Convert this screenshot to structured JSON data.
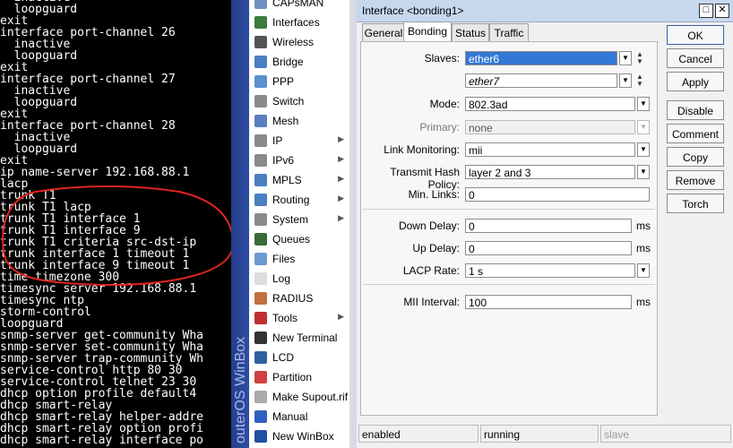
{
  "terminal": {
    "lines": [
      "  inactive",
      "  loopguard",
      "exit",
      "interface port-channel 26",
      "  inactive",
      "  loopguard",
      "exit",
      "interface port-channel 27",
      "  inactive",
      "  loopguard",
      "exit",
      "interface port-channel 28",
      "  inactive",
      "  loopguard",
      "exit",
      "ip name-server 192.168.88.1",
      "lacp",
      "trunk T1",
      "trunk T1 lacp",
      "trunk T1 interface 1",
      "trunk T1 interface 9",
      "trunk T1 criteria src-dst-ip",
      "trunk interface 1 timeout 1",
      "trunk interface 9 timeout 1",
      "time timezone 300",
      "timesync server 192.168.88.1",
      "timesync ntp",
      "storm-control",
      "loopguard",
      "snmp-server get-community Wha",
      "snmp-server set-community Wha",
      "snmp-server trap-community Wh",
      "service-control http 80 30",
      "service-control telnet 23 30",
      "dhcp option profile default4",
      "dhcp smart-relay",
      "dhcp smart-relay helper-addre",
      "dhcp smart-relay option profi",
      "dhcp smart-relay interface po"
    ]
  },
  "sidebar_brand": "outerOS WinBox",
  "menu": [
    {
      "label": "CAPsMAN",
      "icon": "capsman-icon",
      "color": "#6f8fc0",
      "arrow": false
    },
    {
      "label": "Interfaces",
      "icon": "interfaces-icon",
      "color": "#3b7b3b",
      "arrow": false
    },
    {
      "label": "Wireless",
      "icon": "wireless-icon",
      "color": "#555555",
      "arrow": false
    },
    {
      "label": "Bridge",
      "icon": "bridge-icon",
      "color": "#4a7fc0",
      "arrow": false
    },
    {
      "label": "PPP",
      "icon": "ppp-icon",
      "color": "#5a8fd0",
      "arrow": false
    },
    {
      "label": "Switch",
      "icon": "switch-icon",
      "color": "#8a8a8a",
      "arrow": false
    },
    {
      "label": "Mesh",
      "icon": "mesh-icon",
      "color": "#5a7fc0",
      "arrow": false
    },
    {
      "label": "IP",
      "icon": "ip-icon",
      "color": "#8a8a8a",
      "arrow": true
    },
    {
      "label": "IPv6",
      "icon": "ipv6-icon",
      "color": "#8a8a8a",
      "arrow": true
    },
    {
      "label": "MPLS",
      "icon": "mpls-icon",
      "color": "#4a7fc0",
      "arrow": true
    },
    {
      "label": "Routing",
      "icon": "routing-icon",
      "color": "#4a7fc0",
      "arrow": true
    },
    {
      "label": "System",
      "icon": "system-icon",
      "color": "#8a8a8a",
      "arrow": true
    },
    {
      "label": "Queues",
      "icon": "queues-icon",
      "color": "#3a6a3a",
      "arrow": false
    },
    {
      "label": "Files",
      "icon": "files-icon",
      "color": "#6a9ad0",
      "arrow": false
    },
    {
      "label": "Log",
      "icon": "log-icon",
      "color": "#dddddd",
      "arrow": false
    },
    {
      "label": "RADIUS",
      "icon": "radius-icon",
      "color": "#c07040",
      "arrow": false
    },
    {
      "label": "Tools",
      "icon": "tools-icon",
      "color": "#c03030",
      "arrow": true
    },
    {
      "label": "New Terminal",
      "icon": "terminal-icon",
      "color": "#333333",
      "arrow": false
    },
    {
      "label": "LCD",
      "icon": "lcd-icon",
      "color": "#3060a0",
      "arrow": false
    },
    {
      "label": "Partition",
      "icon": "partition-icon",
      "color": "#d04040",
      "arrow": false
    },
    {
      "label": "Make Supout.rif",
      "icon": "supout-icon",
      "color": "#aaaaaa",
      "arrow": false
    },
    {
      "label": "Manual",
      "icon": "manual-icon",
      "color": "#3060c0",
      "arrow": false
    },
    {
      "label": "New WinBox",
      "icon": "winbox-icon",
      "color": "#2050a0",
      "arrow": false
    }
  ],
  "dialog": {
    "title": "Interface <bonding1>",
    "tabs": [
      "General",
      "Bonding",
      "Status",
      "Traffic"
    ],
    "active_tab": "Bonding",
    "fields": {
      "slaves_label": "Slaves:",
      "slave1": "ether6",
      "slave2": "ether7",
      "mode_label": "Mode:",
      "mode_value": "802.3ad",
      "primary_label": "Primary:",
      "primary_value": "none",
      "link_monitoring_label": "Link Monitoring:",
      "link_monitoring_value": "mii",
      "hash_policy_label": "Transmit Hash Policy:",
      "hash_policy_value": "layer 2 and 3",
      "min_links_label": "Min. Links:",
      "min_links_value": "0",
      "down_delay_label": "Down Delay:",
      "down_delay_value": "0",
      "up_delay_label": "Up Delay:",
      "up_delay_value": "0",
      "lacp_rate_label": "LACP Rate:",
      "lacp_rate_value": "1 s",
      "mii_interval_label": "MII Interval:",
      "mii_interval_value": "100",
      "unit_ms": "ms"
    },
    "buttons": [
      "OK",
      "Cancel",
      "Apply",
      "Disable",
      "Comment",
      "Copy",
      "Remove",
      "Torch"
    ],
    "status": [
      "enabled",
      "running",
      "slave"
    ]
  }
}
